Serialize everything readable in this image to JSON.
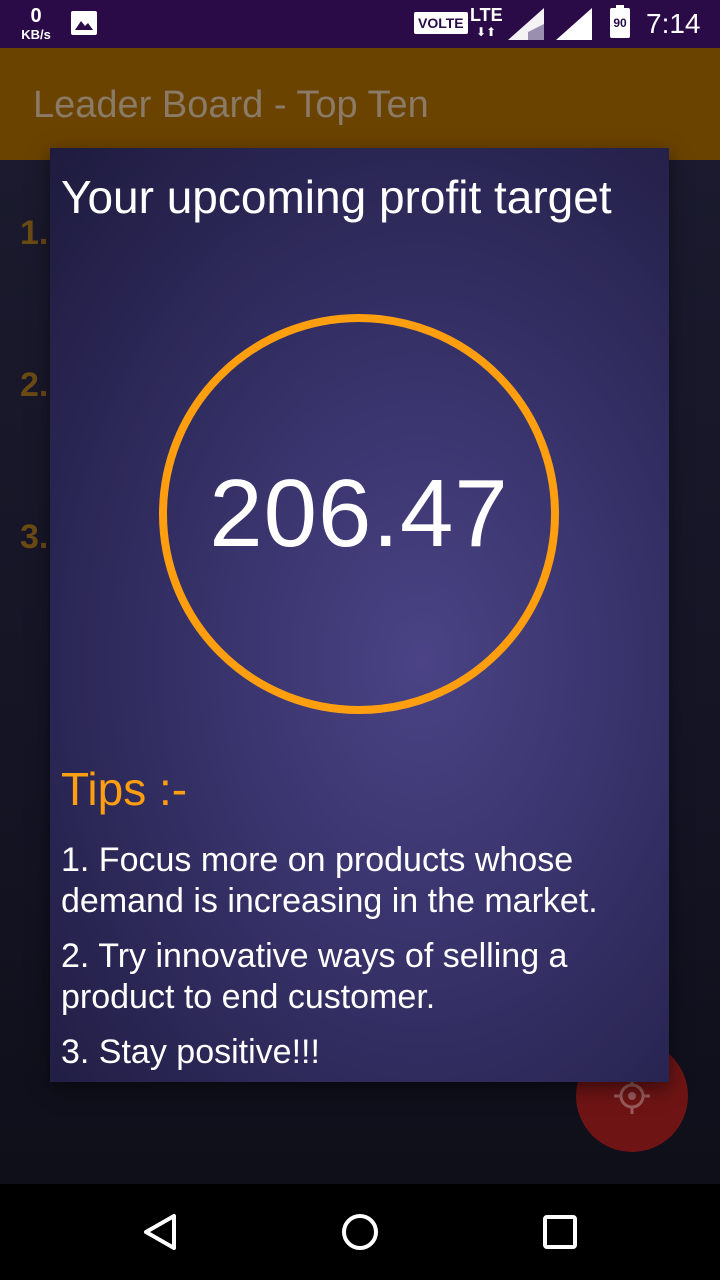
{
  "status_bar": {
    "net_speed_value": "0",
    "net_speed_unit": "KB/s",
    "volte": "VOLTE",
    "network": "LTE",
    "battery": "90",
    "time": "7:14"
  },
  "app_bar": {
    "title": "Leader Board - Top Ten"
  },
  "background": {
    "ranks": [
      "1.",
      "2.",
      "3."
    ]
  },
  "dialog": {
    "title": "Your upcoming profit target",
    "target_value": "206.47",
    "tips_heading": "Tips :-",
    "tips": [
      "1. Focus more on products whose demand is increasing in the market.",
      "2. Try innovative ways of selling a product to end customer.",
      "3. Stay positive!!!"
    ]
  },
  "colors": {
    "accent": "#ff9f10",
    "status_bar": "#2a0b48",
    "app_bar_dimmed": "#6b4300",
    "fab_dimmed": "#6e1414"
  },
  "icons": {
    "gallery": "image-icon",
    "signal": "signal-icon",
    "fab": "crosshair-icon",
    "back": "back-icon",
    "home": "home-icon",
    "recents": "recents-icon"
  }
}
